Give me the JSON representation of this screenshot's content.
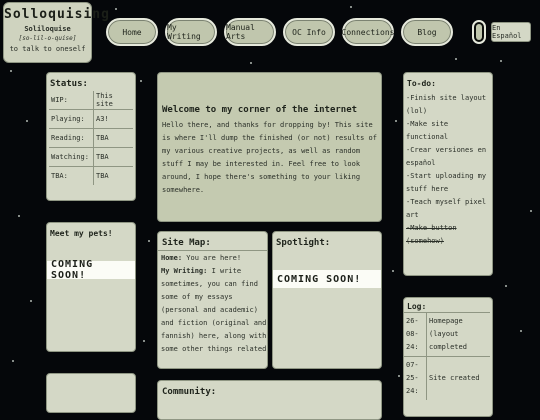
{
  "logo": {
    "wordmark": "Solloquising",
    "subtitle": "Soliloquise",
    "phonetic": "[so-lil-o-quise]",
    "definition": "to talk to oneself"
  },
  "nav": {
    "items": [
      "Home",
      "My Writing",
      "Manual Arts",
      "OC Info",
      "Connections",
      "Blog"
    ],
    "language_button": "En Español"
  },
  "status": {
    "title": "Status:",
    "rows": [
      {
        "key": "WIP:",
        "value": "This site"
      },
      {
        "key": "Playing:",
        "value": "A3!"
      },
      {
        "key": "Reading:",
        "value": "TBA"
      },
      {
        "key": "Watching:",
        "value": "TBA"
      },
      {
        "key": "TBA:",
        "value": "TBA"
      }
    ]
  },
  "pets": {
    "title": "Meet my pets!",
    "coming_soon": "COMING SOON!"
  },
  "welcome": {
    "title": "Welcome to my corner of the internet",
    "body": "Hello there, and thanks for dropping by! This site is where I'll dump the finished (or not) results of my various creative projects, as well as random stuff I may be interested in. Feel free to look around, I hope there's something to your liking somewhere."
  },
  "sitemap": {
    "title": "Site Map:",
    "home_label": "Home:",
    "home_text": " You are here!",
    "writing_label": "My Writing:",
    "writing_text": " I write sometimes, you can find some of my essays (personal and academic) and fiction (original and fannish) here, along with some other things related"
  },
  "spotlight": {
    "title": "Spotlight:",
    "coming_soon": "COMING SOON!"
  },
  "community": {
    "title": "Community:"
  },
  "todo": {
    "title": "To-do:",
    "items": [
      {
        "text": "-Finish site layout (lol)",
        "done": false
      },
      {
        "text": "-Make site functional",
        "done": false
      },
      {
        "text": "-Crear versiones en español",
        "done": false
      },
      {
        "text": "-Start uploading my stuff here",
        "done": false
      },
      {
        "text": "-Teach myself pixel art",
        "done": false
      },
      {
        "text": "-Make button (somehow)",
        "done": true
      }
    ]
  },
  "log": {
    "title": "Log:",
    "entries": [
      {
        "date": "26-08-24:",
        "text": "Homepage (layout completed"
      },
      {
        "date": "07-25-24:",
        "text": "Site created"
      }
    ]
  },
  "colors": {
    "background": "#05070a",
    "panel": "#d4d8c6",
    "panel_dark": "#c4cab0",
    "accent_border": "#8f9683"
  }
}
